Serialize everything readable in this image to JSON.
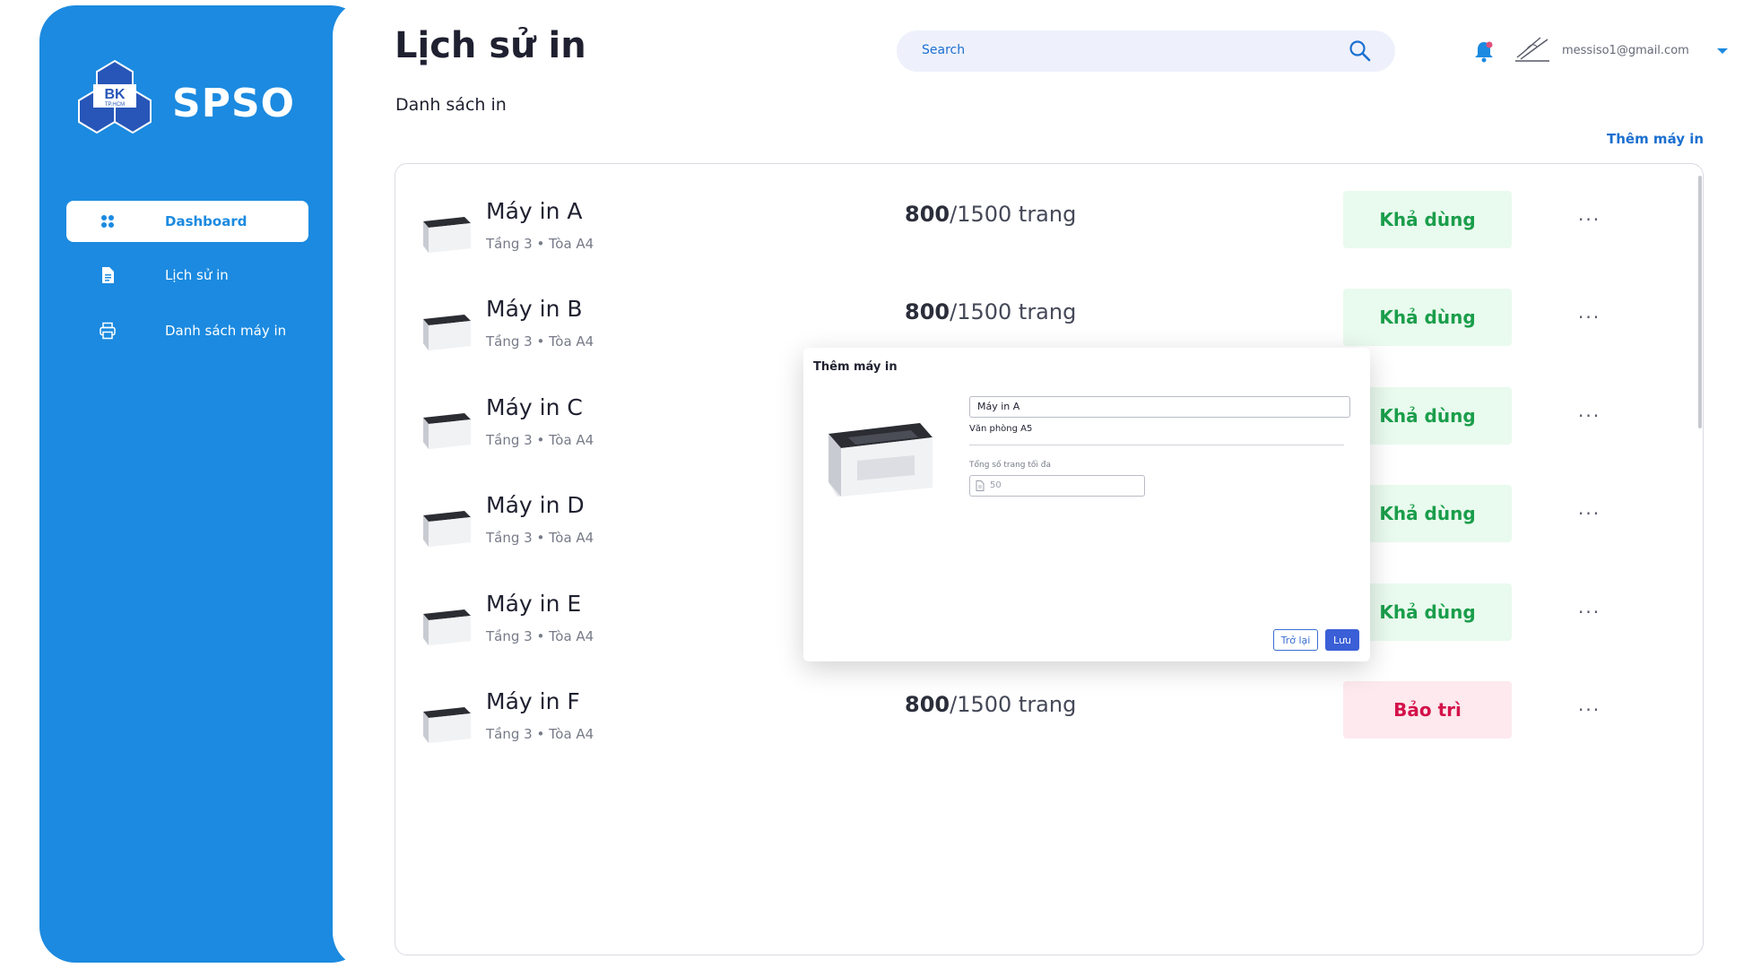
{
  "brand": {
    "name": "SPSO",
    "logo_text": "BK",
    "logo_subtext": "TP.HCM"
  },
  "nav": [
    {
      "label": "Dashboard",
      "icon": "grid-icon",
      "active": true
    },
    {
      "label": "Lịch sử in",
      "icon": "document-icon",
      "active": false
    },
    {
      "label": "Danh sách máy in",
      "icon": "printer-icon",
      "active": false
    }
  ],
  "header": {
    "title": "Lịch sử in",
    "subtitle": "Danh sách in",
    "search_placeholder": "Search",
    "user_email": "messiso1@gmail.com",
    "add_printer_link": "Thêm máy in"
  },
  "printers": [
    {
      "name": "Máy in A",
      "location": "Tầng 3 • Tòa A4",
      "pages_used": "800",
      "pages_total": "/1500 trang",
      "status": "Khả dùng"
    },
    {
      "name": "Máy in B",
      "location": "Tầng 3 • Tòa A4",
      "pages_used": "800",
      "pages_total": "/1500 trang",
      "status": "Khả dùng"
    },
    {
      "name": "Máy in C",
      "location": "Tầng 3 • Tòa A4",
      "pages_used": "",
      "pages_total": "",
      "status": "Khả dùng"
    },
    {
      "name": "Máy in D",
      "location": "Tầng 3 • Tòa A4",
      "pages_used": "",
      "pages_total": "",
      "status": "Khả dùng"
    },
    {
      "name": "Máy in E",
      "location": "Tầng 3 • Tòa A4",
      "pages_used": "",
      "pages_total": "",
      "status": "Khả dùng"
    },
    {
      "name": "Máy in F",
      "location": "Tầng 3 • Tòa A4",
      "pages_used": "800",
      "pages_total": "/1500 trang",
      "status": "Bảo trì"
    }
  ],
  "row_more": "···",
  "modal": {
    "title": "Thêm máy in",
    "name_value": "Máy in A",
    "location": "Văn phòng A5",
    "max_pages_label": "Tổng số trang tối đa",
    "max_pages_placeholder": "50",
    "back_button": "Trở lại",
    "save_button": "Lưu"
  },
  "colors": {
    "sidebar": "#1b8ae0",
    "available_bg": "#e9faee",
    "available_text": "#1a9e4b",
    "maintenance_bg": "#fde9ee",
    "maintenance_text": "#d4124a"
  }
}
